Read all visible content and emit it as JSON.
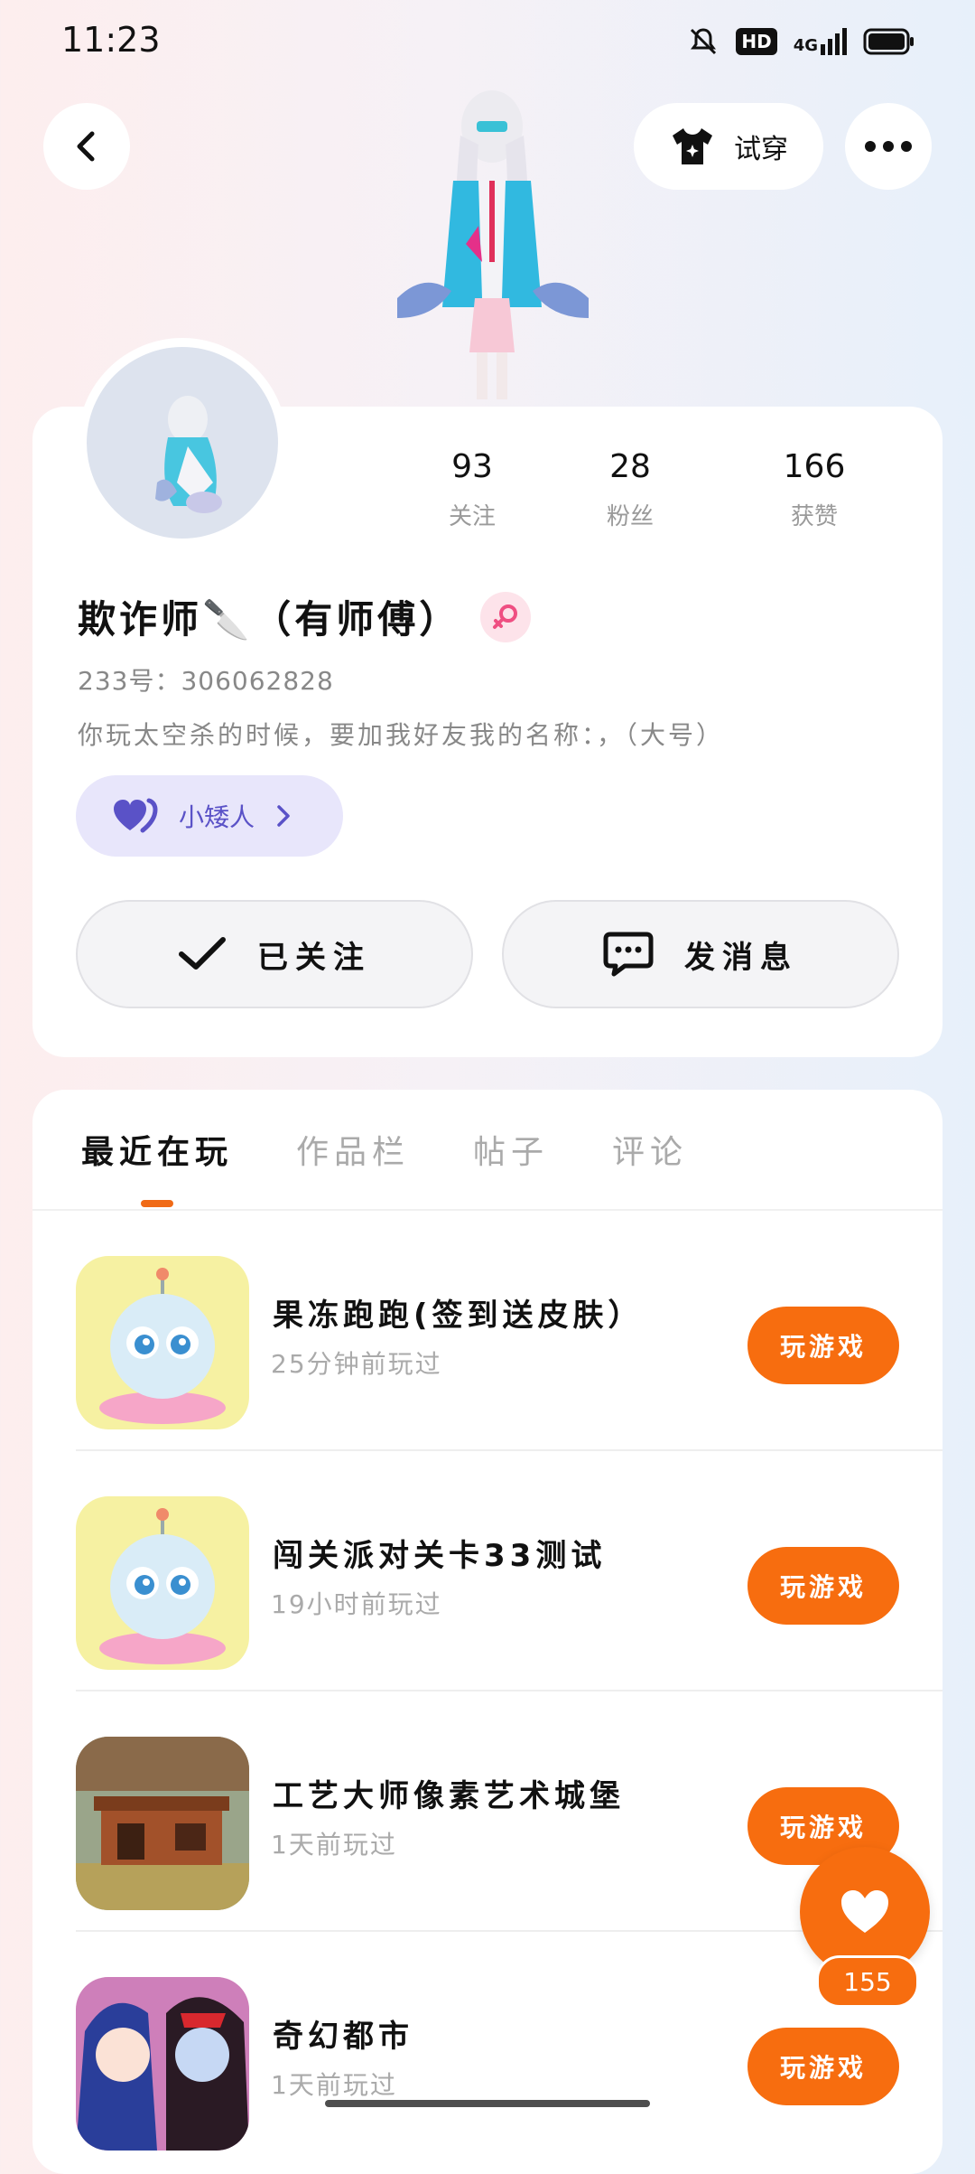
{
  "status": {
    "time": "11:23",
    "hd": "HD",
    "network": "4G"
  },
  "header": {
    "try_on_label": "试穿"
  },
  "profile": {
    "stats": [
      {
        "value": "93",
        "label": "关注"
      },
      {
        "value": "28",
        "label": "粉丝"
      },
      {
        "value": "166",
        "label": "获赞"
      }
    ],
    "username": "欺诈师🔪（有师傅）",
    "uid": "233号：306062828",
    "bio": "你玩太空杀的时候，要加我好友我的名称：，（大号）",
    "group_label": "小矮人",
    "follow_label": "已关注",
    "message_label": "发消息"
  },
  "tabs": [
    "最近在玩",
    "作品栏",
    "帖子",
    "评论"
  ],
  "games": [
    {
      "title": "果冻跑跑(签到送皮肤）",
      "subtitle": "25分钟前玩过",
      "button": "玩游戏"
    },
    {
      "title": "闯关派对关卡33测试",
      "subtitle": "19小时前玩过",
      "button": "玩游戏"
    },
    {
      "title": "工艺大师像素艺术城堡",
      "subtitle": "1天前玩过",
      "button": "玩游戏"
    },
    {
      "title": "奇幻都市",
      "subtitle": "1天前玩过",
      "button": "玩游戏"
    }
  ],
  "likes": {
    "count": "155"
  },
  "colors": {
    "accent": "#f76d0f",
    "group_purple": "#5a52c7"
  }
}
